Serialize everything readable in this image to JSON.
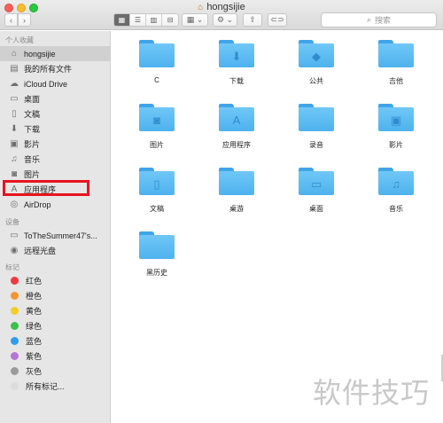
{
  "window": {
    "title": "hongsijie"
  },
  "toolbar": {
    "back_glyph": "‹",
    "forward_glyph": "›",
    "views": [
      "▦",
      "☰",
      "▥",
      "⊟"
    ],
    "arrange_glyph": "▦ ⌄",
    "action_glyph": "⚙ ⌄",
    "share_glyph": "⇪",
    "tags_glyph": "⊂⊃",
    "search_placeholder": "搜索"
  },
  "sidebar": {
    "favorites_header": "个人收藏",
    "favorites": [
      {
        "label": "hongsijie",
        "icon": "home-icon",
        "glyph": "⌂",
        "selected": true
      },
      {
        "label": "我的所有文件",
        "icon": "all-files-icon",
        "glyph": "▤"
      },
      {
        "label": "iCloud Drive",
        "icon": "cloud-icon",
        "glyph": "☁"
      },
      {
        "label": "桌面",
        "icon": "desktop-icon",
        "glyph": "▭"
      },
      {
        "label": "文稿",
        "icon": "documents-icon",
        "glyph": "▯"
      },
      {
        "label": "下载",
        "icon": "download-icon",
        "glyph": "⬇"
      },
      {
        "label": "影片",
        "icon": "movies-icon",
        "glyph": "▣"
      },
      {
        "label": "音乐",
        "icon": "music-icon",
        "glyph": "♫"
      },
      {
        "label": "图片",
        "icon": "camera-icon",
        "glyph": "◙"
      },
      {
        "label": "应用程序",
        "icon": "applications-icon",
        "glyph": "A"
      },
      {
        "label": "AirDrop",
        "icon": "airdrop-icon",
        "glyph": "◎"
      }
    ],
    "devices_header": "设备",
    "devices": [
      {
        "label": "ToTheSummer47's...",
        "icon": "laptop-icon",
        "glyph": "▭"
      },
      {
        "label": "远程光盘",
        "icon": "disc-icon",
        "glyph": "◉"
      }
    ],
    "tags_header": "标记",
    "tags": [
      {
        "label": "红色",
        "color": "#f2393d"
      },
      {
        "label": "橙色",
        "color": "#f5962d"
      },
      {
        "label": "黄色",
        "color": "#f3cd26"
      },
      {
        "label": "绿色",
        "color": "#3cc048"
      },
      {
        "label": "蓝色",
        "color": "#2f9cf0"
      },
      {
        "label": "紫色",
        "color": "#b674d8"
      },
      {
        "label": "灰色",
        "color": "#9a9a9a"
      },
      {
        "label": "所有标记...",
        "color": "#dcdcdc"
      }
    ]
  },
  "files": [
    {
      "name": "C",
      "glyph": ""
    },
    {
      "name": "下载",
      "glyph": "⬇"
    },
    {
      "name": "公共",
      "glyph": "◆"
    },
    {
      "name": "吉他",
      "glyph": ""
    },
    {
      "name": "图片",
      "glyph": "◙"
    },
    {
      "name": "应用程序",
      "glyph": "A"
    },
    {
      "name": "录音",
      "glyph": ""
    },
    {
      "name": "影片",
      "glyph": "▣"
    },
    {
      "name": "文稿",
      "glyph": "▯"
    },
    {
      "name": "桌游",
      "glyph": ""
    },
    {
      "name": "桌面",
      "glyph": "▭"
    },
    {
      "name": "音乐",
      "glyph": "♫"
    },
    {
      "name": "黑历史",
      "glyph": ""
    }
  ],
  "watermark": "软件技巧"
}
